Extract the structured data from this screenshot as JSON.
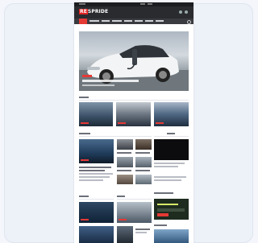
{
  "site": {
    "logo_prefix": "RE",
    "logo_rest": "SPRIDE"
  },
  "colors": {
    "background": "#edf1f8",
    "header": "#2a2b2f",
    "nav": "#3a3b40",
    "accent": "#e53935"
  },
  "icons": [
    "search-icon",
    "menu-icon"
  ]
}
